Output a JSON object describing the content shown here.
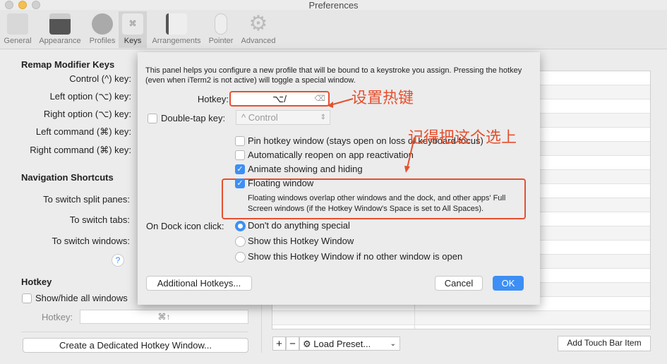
{
  "window": {
    "title": "Preferences"
  },
  "toolbar": [
    {
      "label": "General",
      "icon": "general-icon"
    },
    {
      "label": "Appearance",
      "icon": "appearance-icon"
    },
    {
      "label": "Profiles",
      "icon": "profiles-icon"
    },
    {
      "label": "Keys",
      "icon": "keys-icon",
      "selected": true
    },
    {
      "label": "Arrangements",
      "icon": "arrangements-icon"
    },
    {
      "label": "Pointer",
      "icon": "pointer-icon"
    },
    {
      "label": "Advanced",
      "icon": "gear-icon"
    }
  ],
  "left": {
    "remap_header": "Remap Modifier Keys",
    "remap": [
      "Control (^) key:",
      "Left option (⌥) key:",
      "Right option (⌥) key:",
      "Left command (⌘) key:",
      "Right command (⌘) key:"
    ],
    "nav_header": "Navigation Shortcuts",
    "nav": [
      "To switch split panes:",
      "To switch tabs:",
      "To switch windows:"
    ],
    "help": "?",
    "hotkey_header": "Hotkey",
    "show_hide": "Show/hide all windows",
    "hotkey_label": "Hotkey:",
    "hotkey_value": "⌘↑",
    "create_button": "Create a Dedicated Hotkey Window..."
  },
  "bottom": {
    "plus": "+",
    "minus": "−",
    "load_preset": "Load Preset...",
    "add_touch_bar": "Add Touch Bar Item"
  },
  "sheet": {
    "description": "This panel helps you configure a new profile that will be bound to a keystroke you assign. Pressing the hotkey (even when iTerm2 is not active) will toggle a special window.",
    "hotkey_label": "Hotkey:",
    "hotkey_value": "⌥/",
    "double_tap_label": "Double-tap key:",
    "double_tap_value": "^ Control",
    "options": [
      {
        "label": "Pin hotkey window (stays open on loss of keyboard focus)",
        "checked": false
      },
      {
        "label": "Automatically reopen on app reactivation",
        "checked": false
      },
      {
        "label": "Animate showing and hiding",
        "checked": true
      },
      {
        "label": "Floating window",
        "checked": true
      }
    ],
    "floating_note": "Floating windows overlap other windows and the dock, and other apps' Full Screen windows (if the Hotkey Window's Space is set to All Spaces).",
    "dock_label": "On Dock icon click:",
    "dock_options": [
      {
        "label": "Don't do anything special",
        "selected": true
      },
      {
        "label": "Show this Hotkey Window",
        "selected": false
      },
      {
        "label": "Show this Hotkey Window if no other window is open",
        "selected": false
      }
    ],
    "additional": "Additional Hotkeys...",
    "cancel": "Cancel",
    "ok": "OK"
  },
  "annotations": {
    "set_hotkey": "设置热键",
    "check_this": "记得把这个选上",
    "color": "#e5502e"
  },
  "colors": {
    "accent": "#3d8ff5"
  }
}
